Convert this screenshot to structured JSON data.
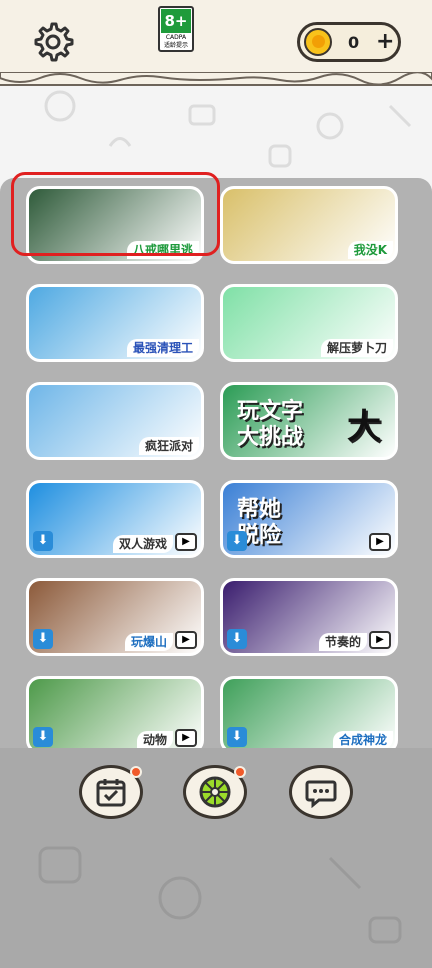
{
  "header": {
    "age_rating": "8+",
    "age_org": "CADPA",
    "age_tip": "适龄提示",
    "coin_count": "0",
    "plus_label": "+"
  },
  "games": [
    {
      "name": "八戒哪里逃",
      "label_color": "#1e9a3c",
      "art_color": "#2f5b3a",
      "download": false,
      "video": false
    },
    {
      "name": "我没K",
      "label_color": "#1e9a3c",
      "art_color": "#d9c06a",
      "download": false,
      "video": false
    },
    {
      "name": "最强清理工",
      "label_color": "#2a52b8",
      "art_color": "#4fa9e2",
      "download": false,
      "video": false
    },
    {
      "name": "解压萝卜刀",
      "label_color": "#333333",
      "art_color": "#7fe0a6",
      "download": false,
      "video": false
    },
    {
      "name": "疯狂派对",
      "label_color": "#333333",
      "art_color": "#6fb6e8",
      "download": false,
      "video": false
    },
    {
      "name": "",
      "label_color": "#333333",
      "art_color": "#2b9c55",
      "download": false,
      "video": false,
      "art_text": [
        "玩文字",
        "大挑战",
        "大"
      ]
    },
    {
      "name": "双人游戏",
      "label_color": "#333333",
      "art_color": "#1f8fe0",
      "download": true,
      "video": true
    },
    {
      "name": "",
      "label_color": "#333333",
      "art_color": "#3a7fd5",
      "download": true,
      "video": true,
      "art_text": [
        "帮她",
        "脱险"
      ]
    },
    {
      "name": "玩爆山",
      "label_color": "#1e6fc0",
      "art_color": "#8c5a3a",
      "download": true,
      "video": true
    },
    {
      "name": "节奏的",
      "label_color": "#333333",
      "art_color": "#3a1d6e",
      "download": true,
      "video": true
    },
    {
      "name": "动物",
      "label_color": "#333333",
      "art_color": "#4e9a4a",
      "download": true,
      "video": true
    },
    {
      "name": "合成神龙",
      "label_color": "#1e6fc0",
      "art_color": "#3fa05a",
      "download": true,
      "video": false
    }
  ],
  "bottom_nav": [
    {
      "icon": "calendar-check-icon",
      "badge": true
    },
    {
      "icon": "wheel-icon",
      "badge": true
    },
    {
      "icon": "chat-icon",
      "badge": false
    }
  ],
  "colors": {
    "highlight": "#e02020",
    "accent": "#f8c21b",
    "overlay": "#a9a9a9"
  }
}
